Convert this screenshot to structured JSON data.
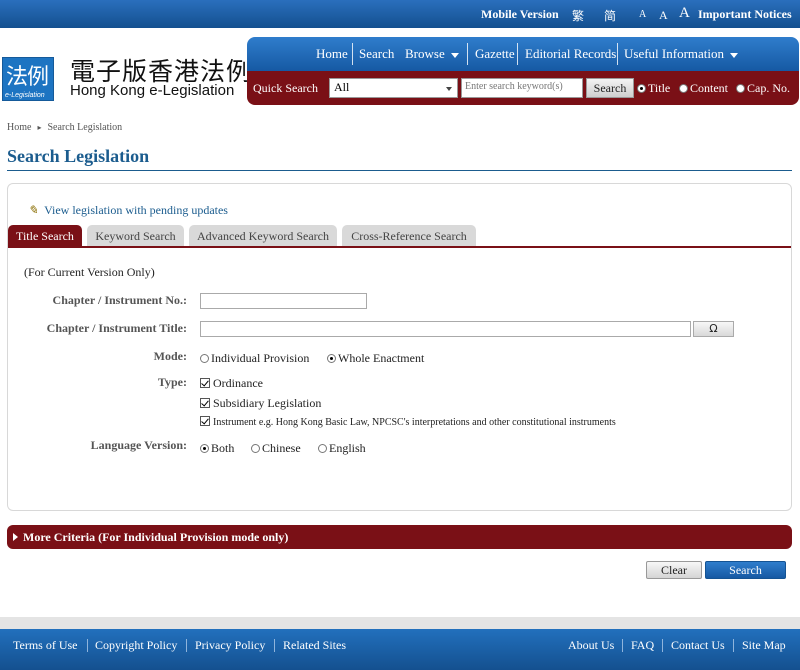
{
  "topbar": {
    "mobile_version": "Mobile Version",
    "traditional": "繁",
    "simplified": "简",
    "font_small": "A",
    "font_medium": "A",
    "font_large": "A",
    "important_notices": "Important Notices"
  },
  "logo": {
    "icon_chars": "法例",
    "icon_sub": "e-Legislation",
    "title_zh": "電子版香港法例",
    "title_en": "Hong Kong e-Legislation"
  },
  "nav": {
    "items": [
      {
        "label": "Home"
      },
      {
        "label": "Search"
      },
      {
        "label": "Browse"
      },
      {
        "label": "Gazette"
      },
      {
        "label": "Editorial Records"
      },
      {
        "label": "Useful Information"
      }
    ]
  },
  "quick_search": {
    "label": "Quick Search",
    "select_value": "All",
    "placeholder": "Enter search keyword(s)",
    "button": "Search",
    "options": [
      {
        "label": "Title",
        "selected": true
      },
      {
        "label": "Content",
        "selected": false
      },
      {
        "label": "Cap. No.",
        "selected": false
      }
    ]
  },
  "breadcrumb": {
    "home": "Home",
    "current": "Search Legislation"
  },
  "page_title": "Search Legislation",
  "pending_link": "View legislation with pending updates",
  "tabs": [
    {
      "label": "Title Search",
      "active": true
    },
    {
      "label": "Keyword Search",
      "active": false
    },
    {
      "label": "Advanced Keyword Search",
      "active": false
    },
    {
      "label": "Cross-Reference Search",
      "active": false
    }
  ],
  "form": {
    "note": "(For Current Version Only)",
    "chapter_no_label": "Chapter / Instrument No.:",
    "chapter_no_value": "",
    "chapter_title_label": "Chapter / Instrument Title:",
    "chapter_title_value": "",
    "special_char_button": "Ω",
    "mode_label": "Mode:",
    "mode_options": [
      {
        "label": "Individual Provision",
        "selected": false
      },
      {
        "label": "Whole Enactment",
        "selected": true
      }
    ],
    "type_label": "Type:",
    "type_options": [
      {
        "label": "Ordinance",
        "checked": true
      },
      {
        "label": "Subsidiary Legislation",
        "checked": true
      },
      {
        "label": "Instrument e.g. Hong Kong Basic Law, NPCSC's interpretations and other constitutional instruments",
        "checked": true
      }
    ],
    "language_label": "Language Version:",
    "language_options": [
      {
        "label": "Both",
        "selected": true
      },
      {
        "label": "Chinese",
        "selected": false
      },
      {
        "label": "English",
        "selected": false
      }
    ]
  },
  "more_criteria": "More Criteria (For Individual Provision mode only)",
  "buttons": {
    "clear": "Clear",
    "search": "Search"
  },
  "footer": {
    "left": [
      "Terms of Use",
      "Copyright Policy",
      "Privacy Policy",
      "Related Sites"
    ],
    "right": [
      "About Us",
      "FAQ",
      "Contact Us",
      "Site Map"
    ]
  }
}
